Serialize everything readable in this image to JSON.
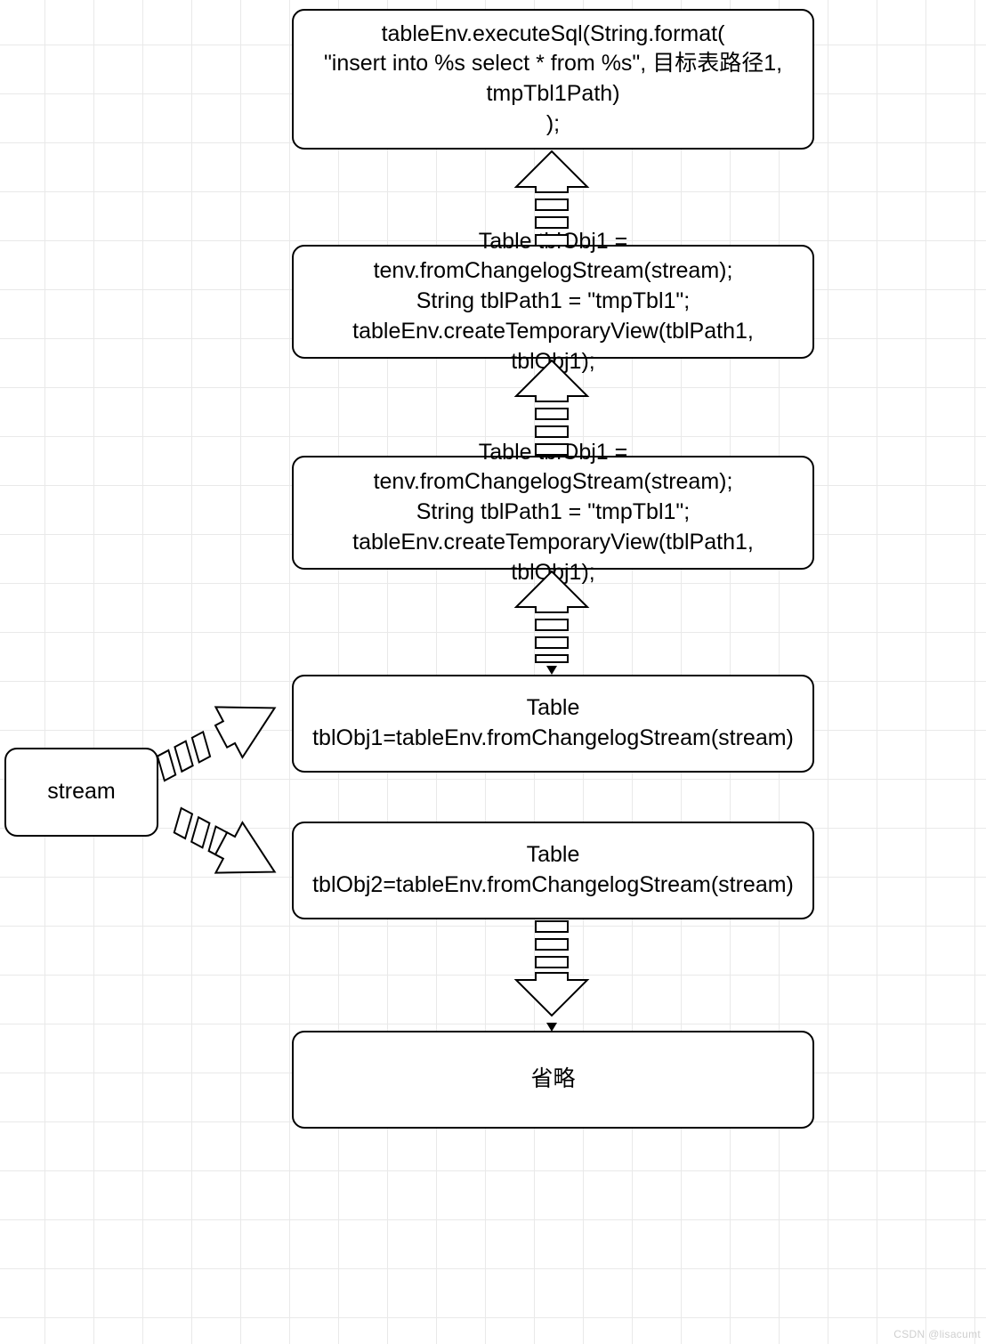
{
  "nodes": {
    "stream": {
      "label": "stream"
    },
    "box1": {
      "line1": "tableEnv.executeSql(String.format(",
      "line2": "\"insert into %s select * from %s\", 目标表路径1,",
      "line3": "tmpTbl1Path)",
      "line4": ");"
    },
    "box2": {
      "line1": "Table tblObj1 = tenv.fromChangelogStream(stream);",
      "line2": "String tblPath1 = \"tmpTbl1\";",
      "line3": "tableEnv.createTemporaryView(tblPath1, tblObj1);"
    },
    "box3": {
      "line1": "Table tblObj1 = tenv.fromChangelogStream(stream);",
      "line2": "String tblPath1 = \"tmpTbl1\";",
      "line3": "tableEnv.createTemporaryView(tblPath1, tblObj1);"
    },
    "box4": {
      "label": "Table tblObj1=tableEnv.fromChangelogStream(stream)"
    },
    "box5": {
      "label": "Table tblObj2=tableEnv.fromChangelogStream(stream)"
    },
    "box6": {
      "label": "省略"
    }
  },
  "watermark": "CSDN @lisacumt"
}
